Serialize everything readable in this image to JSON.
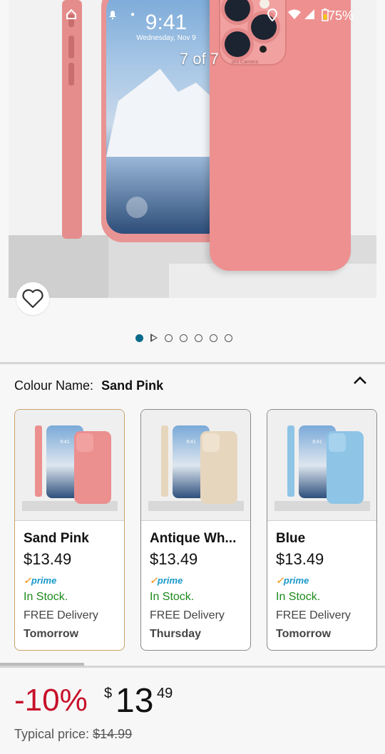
{
  "status_bar": {
    "time": "9:41",
    "battery": "75%"
  },
  "gallery": {
    "counter": "7 of 7",
    "phone_screen_time": "9:41",
    "phone_screen_date": "Wednesday, Nov 9",
    "camera_text": "pro Camera",
    "active_index": 0
  },
  "colour": {
    "label": "Colour Name:",
    "selected": "Sand Pink"
  },
  "variants": [
    {
      "name": "Sand Pink",
      "price": "$13.49",
      "prime": "prime",
      "stock": "In Stock.",
      "delivery": "FREE Delivery",
      "day": "Tomorrow",
      "color": "#ec8f8f"
    },
    {
      "name": "Antique Wh...",
      "price": "$13.49",
      "prime": "prime",
      "stock": "In Stock.",
      "delivery": "FREE Delivery",
      "day": "Thursday",
      "color": "#e7d6be"
    },
    {
      "name": "Blue",
      "price": "$13.49",
      "prime": "prime",
      "stock": "In Stock.",
      "delivery": "FREE Delivery",
      "day": "Tomorrow",
      "color": "#8ec4e6"
    }
  ],
  "price": {
    "discount": "-10%",
    "symbol": "$",
    "whole": "13",
    "fraction": "49",
    "typical_label": "Typical price:",
    "typical_value": "$14.99"
  },
  "colors": {
    "accent_red": "#c7102a",
    "stock_green": "#1c8a1c",
    "prime_blue": "#1a98c9",
    "dot_active": "#0b6b8a"
  }
}
